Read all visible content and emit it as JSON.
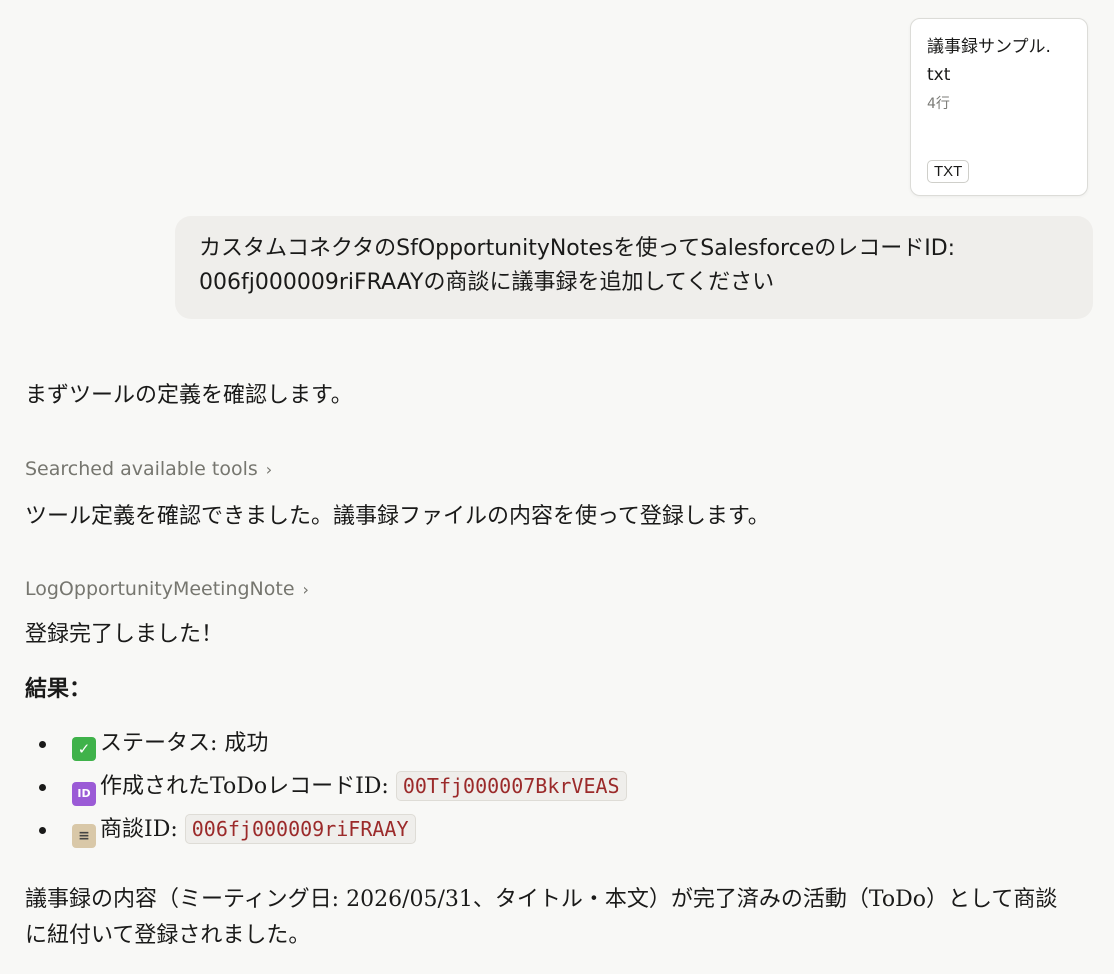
{
  "attachment": {
    "filename": "議事録サンプル.txt",
    "lines": "4行",
    "type": "TXT"
  },
  "user_message": "カスタムコネクタのSfOpportunityNotesを使ってSalesforceのレコードID: 006fj000009riFRAAYの商談に議事録を追加してください",
  "assistant": {
    "intro": "まずツールの定義を確認します。",
    "tool_call_1": "Searched available tools",
    "after_tool_1": "ツール定義を確認できました。議事録ファイルの内容を使って登録します。",
    "tool_call_2": "LogOpportunityMeetingNote",
    "done": "登録完了しました！",
    "results_heading": "結果：",
    "results": [
      {
        "icon": "check-mark-icon",
        "label": "ステータス: 成功",
        "code": ""
      },
      {
        "icon": "id-icon",
        "label": "作成されたToDoレコードID: ",
        "code": "00Tfj000007BkrVEAS"
      },
      {
        "icon": "clipboard-icon",
        "label": "商談ID: ",
        "code": "006fj000009riFRAAY"
      }
    ],
    "summary": "議事録の内容（ミーティング日: 2026/05/31、タイトル・本文）が完了済みの活動（ToDo）として商談に紐付いて登録されました。"
  }
}
